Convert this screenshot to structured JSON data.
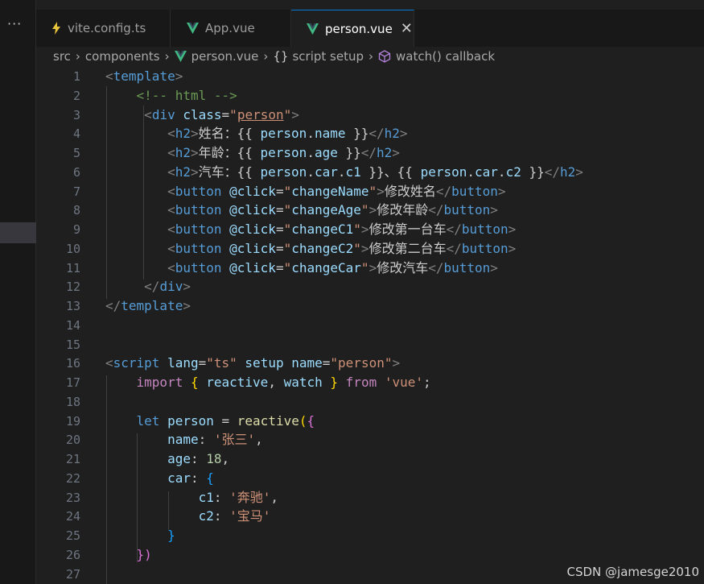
{
  "activity": {
    "more_label": "···"
  },
  "tabs": [
    {
      "label": "vite.config.ts",
      "icon": "lightning-icon",
      "icon_color": "#e8c33c",
      "active": false
    },
    {
      "label": "App.vue",
      "icon": "vue-logo-icon",
      "icon_color": "#41b883",
      "active": false
    },
    {
      "label": "person.vue",
      "icon": "vue-logo-icon",
      "icon_color": "#41b883",
      "active": true,
      "close": "✕"
    }
  ],
  "breadcrumbs": {
    "items": [
      "src",
      "components",
      "person.vue",
      "script setup",
      "watch() callback"
    ],
    "braces": "{}",
    "separator": "›"
  },
  "editor": {
    "line_numbers": [
      "1",
      "2",
      "3",
      "4",
      "5",
      "6",
      "7",
      "8",
      "9",
      "10",
      "11",
      "12",
      "13",
      "14",
      "15",
      "16",
      "17",
      "18",
      "19",
      "20",
      "21",
      "22",
      "23",
      "24",
      "25",
      "26",
      "27"
    ],
    "lines": [
      [
        {
          "t": "<",
          "c": "tag"
        },
        {
          "t": "template",
          "c": "tagname"
        },
        {
          "t": ">",
          "c": "tag"
        }
      ],
      [
        {
          "t": "    ",
          "c": "plain"
        },
        {
          "t": "<!-- html -->",
          "c": "comment"
        }
      ],
      [
        {
          "t": "     ",
          "c": "plain"
        },
        {
          "t": "<",
          "c": "tag"
        },
        {
          "t": "div",
          "c": "tagname"
        },
        {
          "t": " ",
          "c": "plain"
        },
        {
          "t": "class",
          "c": "attr"
        },
        {
          "t": "=",
          "c": "plain"
        },
        {
          "t": "\"",
          "c": "string"
        },
        {
          "t": "person",
          "c": "string-u"
        },
        {
          "t": "\"",
          "c": "string"
        },
        {
          "t": ">",
          "c": "tag"
        }
      ],
      [
        {
          "t": "        ",
          "c": "plain"
        },
        {
          "t": "<",
          "c": "tag"
        },
        {
          "t": "h2",
          "c": "tagname"
        },
        {
          "t": ">",
          "c": "tag"
        },
        {
          "t": "姓名：{{ ",
          "c": "plain"
        },
        {
          "t": "person",
          "c": "var"
        },
        {
          "t": ".",
          "c": "plain"
        },
        {
          "t": "name",
          "c": "var"
        },
        {
          "t": " }}",
          "c": "plain"
        },
        {
          "t": "</",
          "c": "tag"
        },
        {
          "t": "h2",
          "c": "tagname"
        },
        {
          "t": ">",
          "c": "tag"
        }
      ],
      [
        {
          "t": "        ",
          "c": "plain"
        },
        {
          "t": "<",
          "c": "tag"
        },
        {
          "t": "h2",
          "c": "tagname"
        },
        {
          "t": ">",
          "c": "tag"
        },
        {
          "t": "年龄：{{ ",
          "c": "plain"
        },
        {
          "t": "person",
          "c": "var"
        },
        {
          "t": ".",
          "c": "plain"
        },
        {
          "t": "age",
          "c": "var"
        },
        {
          "t": " }}",
          "c": "plain"
        },
        {
          "t": "</",
          "c": "tag"
        },
        {
          "t": "h2",
          "c": "tagname"
        },
        {
          "t": ">",
          "c": "tag"
        }
      ],
      [
        {
          "t": "        ",
          "c": "plain"
        },
        {
          "t": "<",
          "c": "tag"
        },
        {
          "t": "h2",
          "c": "tagname"
        },
        {
          "t": ">",
          "c": "tag"
        },
        {
          "t": "汽车：{{ ",
          "c": "plain"
        },
        {
          "t": "person",
          "c": "var"
        },
        {
          "t": ".",
          "c": "plain"
        },
        {
          "t": "car",
          "c": "var"
        },
        {
          "t": ".",
          "c": "plain"
        },
        {
          "t": "c1",
          "c": "var"
        },
        {
          "t": " }}、{{ ",
          "c": "plain"
        },
        {
          "t": "person",
          "c": "var"
        },
        {
          "t": ".",
          "c": "plain"
        },
        {
          "t": "car",
          "c": "var"
        },
        {
          "t": ".",
          "c": "plain"
        },
        {
          "t": "c2",
          "c": "var"
        },
        {
          "t": " }}",
          "c": "plain"
        },
        {
          "t": "</",
          "c": "tag"
        },
        {
          "t": "h2",
          "c": "tagname"
        },
        {
          "t": ">",
          "c": "tag"
        }
      ],
      [
        {
          "t": "        ",
          "c": "plain"
        },
        {
          "t": "<",
          "c": "tag"
        },
        {
          "t": "button",
          "c": "tagname"
        },
        {
          "t": " ",
          "c": "plain"
        },
        {
          "t": "@click",
          "c": "attr"
        },
        {
          "t": "=",
          "c": "plain"
        },
        {
          "t": "\"",
          "c": "string"
        },
        {
          "t": "changeName",
          "c": "var"
        },
        {
          "t": "\"",
          "c": "string"
        },
        {
          "t": ">",
          "c": "tag"
        },
        {
          "t": "修改姓名",
          "c": "plain"
        },
        {
          "t": "</",
          "c": "tag"
        },
        {
          "t": "button",
          "c": "tagname"
        },
        {
          "t": ">",
          "c": "tag"
        }
      ],
      [
        {
          "t": "        ",
          "c": "plain"
        },
        {
          "t": "<",
          "c": "tag"
        },
        {
          "t": "button",
          "c": "tagname"
        },
        {
          "t": " ",
          "c": "plain"
        },
        {
          "t": "@click",
          "c": "attr"
        },
        {
          "t": "=",
          "c": "plain"
        },
        {
          "t": "\"",
          "c": "string"
        },
        {
          "t": "changeAge",
          "c": "var"
        },
        {
          "t": "\"",
          "c": "string"
        },
        {
          "t": ">",
          "c": "tag"
        },
        {
          "t": "修改年龄",
          "c": "plain"
        },
        {
          "t": "</",
          "c": "tag"
        },
        {
          "t": "button",
          "c": "tagname"
        },
        {
          "t": ">",
          "c": "tag"
        }
      ],
      [
        {
          "t": "        ",
          "c": "plain"
        },
        {
          "t": "<",
          "c": "tag"
        },
        {
          "t": "button",
          "c": "tagname"
        },
        {
          "t": " ",
          "c": "plain"
        },
        {
          "t": "@click",
          "c": "attr"
        },
        {
          "t": "=",
          "c": "plain"
        },
        {
          "t": "\"",
          "c": "string"
        },
        {
          "t": "changeC1",
          "c": "var"
        },
        {
          "t": "\"",
          "c": "string"
        },
        {
          "t": ">",
          "c": "tag"
        },
        {
          "t": "修改第一台车",
          "c": "plain"
        },
        {
          "t": "</",
          "c": "tag"
        },
        {
          "t": "button",
          "c": "tagname"
        },
        {
          "t": ">",
          "c": "tag"
        }
      ],
      [
        {
          "t": "        ",
          "c": "plain"
        },
        {
          "t": "<",
          "c": "tag"
        },
        {
          "t": "button",
          "c": "tagname"
        },
        {
          "t": " ",
          "c": "plain"
        },
        {
          "t": "@click",
          "c": "attr"
        },
        {
          "t": "=",
          "c": "plain"
        },
        {
          "t": "\"",
          "c": "string"
        },
        {
          "t": "changeC2",
          "c": "var"
        },
        {
          "t": "\"",
          "c": "string"
        },
        {
          "t": ">",
          "c": "tag"
        },
        {
          "t": "修改第二台车",
          "c": "plain"
        },
        {
          "t": "</",
          "c": "tag"
        },
        {
          "t": "button",
          "c": "tagname"
        },
        {
          "t": ">",
          "c": "tag"
        }
      ],
      [
        {
          "t": "        ",
          "c": "plain"
        },
        {
          "t": "<",
          "c": "tag"
        },
        {
          "t": "button",
          "c": "tagname"
        },
        {
          "t": " ",
          "c": "plain"
        },
        {
          "t": "@click",
          "c": "attr"
        },
        {
          "t": "=",
          "c": "plain"
        },
        {
          "t": "\"",
          "c": "string"
        },
        {
          "t": "changeCar",
          "c": "var"
        },
        {
          "t": "\"",
          "c": "string"
        },
        {
          "t": ">",
          "c": "tag"
        },
        {
          "t": "修改汽车",
          "c": "plain"
        },
        {
          "t": "</",
          "c": "tag"
        },
        {
          "t": "button",
          "c": "tagname"
        },
        {
          "t": ">",
          "c": "tag"
        }
      ],
      [
        {
          "t": "     ",
          "c": "plain"
        },
        {
          "t": "</",
          "c": "tag"
        },
        {
          "t": "div",
          "c": "tagname"
        },
        {
          "t": ">",
          "c": "tag"
        }
      ],
      [
        {
          "t": "</",
          "c": "tag"
        },
        {
          "t": "template",
          "c": "tagname"
        },
        {
          "t": ">",
          "c": "tag"
        }
      ],
      [],
      [],
      [
        {
          "t": "<",
          "c": "tag"
        },
        {
          "t": "script",
          "c": "tagname"
        },
        {
          "t": " ",
          "c": "plain"
        },
        {
          "t": "lang",
          "c": "attr"
        },
        {
          "t": "=",
          "c": "plain"
        },
        {
          "t": "\"ts\"",
          "c": "string"
        },
        {
          "t": " ",
          "c": "plain"
        },
        {
          "t": "setup",
          "c": "attr"
        },
        {
          "t": " ",
          "c": "plain"
        },
        {
          "t": "name",
          "c": "attr"
        },
        {
          "t": "=",
          "c": "plain"
        },
        {
          "t": "\"person\"",
          "c": "string"
        },
        {
          "t": ">",
          "c": "tag"
        }
      ],
      [
        {
          "t": "    ",
          "c": "plain"
        },
        {
          "t": "import",
          "c": "keyword"
        },
        {
          "t": " ",
          "c": "plain"
        },
        {
          "t": "{",
          "c": "brace"
        },
        {
          "t": " ",
          "c": "plain"
        },
        {
          "t": "reactive",
          "c": "var"
        },
        {
          "t": ", ",
          "c": "plain"
        },
        {
          "t": "watch",
          "c": "var"
        },
        {
          "t": " ",
          "c": "plain"
        },
        {
          "t": "}",
          "c": "brace"
        },
        {
          "t": " ",
          "c": "plain"
        },
        {
          "t": "from",
          "c": "keyword"
        },
        {
          "t": " ",
          "c": "plain"
        },
        {
          "t": "'vue'",
          "c": "string"
        },
        {
          "t": ";",
          "c": "plain"
        }
      ],
      [],
      [
        {
          "t": "    ",
          "c": "plain"
        },
        {
          "t": "let",
          "c": "storage"
        },
        {
          "t": " ",
          "c": "plain"
        },
        {
          "t": "person",
          "c": "var"
        },
        {
          "t": " = ",
          "c": "plain"
        },
        {
          "t": "reactive",
          "c": "func"
        },
        {
          "t": "(",
          "c": "brace"
        },
        {
          "t": "{",
          "c": "paren"
        }
      ],
      [
        {
          "t": "        ",
          "c": "plain"
        },
        {
          "t": "name",
          "c": "var"
        },
        {
          "t": ": ",
          "c": "plain"
        },
        {
          "t": "'张三'",
          "c": "string"
        },
        {
          "t": ",",
          "c": "plain"
        }
      ],
      [
        {
          "t": "        ",
          "c": "plain"
        },
        {
          "t": "age",
          "c": "var"
        },
        {
          "t": ": ",
          "c": "plain"
        },
        {
          "t": "18",
          "c": "number"
        },
        {
          "t": ",",
          "c": "plain"
        }
      ],
      [
        {
          "t": "        ",
          "c": "plain"
        },
        {
          "t": "car",
          "c": "var"
        },
        {
          "t": ": ",
          "c": "plain"
        },
        {
          "t": "{",
          "c": "brace3"
        }
      ],
      [
        {
          "t": "            ",
          "c": "plain"
        },
        {
          "t": "c1",
          "c": "var"
        },
        {
          "t": ": ",
          "c": "plain"
        },
        {
          "t": "'奔驰'",
          "c": "string"
        },
        {
          "t": ",",
          "c": "plain"
        }
      ],
      [
        {
          "t": "            ",
          "c": "plain"
        },
        {
          "t": "c2",
          "c": "var"
        },
        {
          "t": ": ",
          "c": "plain"
        },
        {
          "t": "'宝马'",
          "c": "string"
        }
      ],
      [
        {
          "t": "        ",
          "c": "plain"
        },
        {
          "t": "}",
          "c": "brace3"
        }
      ],
      [
        {
          "t": "    ",
          "c": "plain"
        },
        {
          "t": "})",
          "c": "paren"
        }
      ],
      []
    ]
  },
  "watermark": "CSDN @jamesge2010",
  "colors": {
    "tag": "#808080",
    "tagname": "#569cd6",
    "attr": "#9cdcfe",
    "string": "#ce9178",
    "string-u": "#ce9178",
    "comment": "#6a9955",
    "var": "#9cdcfe",
    "plain": "#cccccc",
    "keyword": "#c586c0",
    "storage": "#569cd6",
    "func": "#dcdcaa",
    "number": "#b5cea8",
    "brace": "#ffd700",
    "paren": "#da70d6",
    "brace3": "#179fff"
  }
}
